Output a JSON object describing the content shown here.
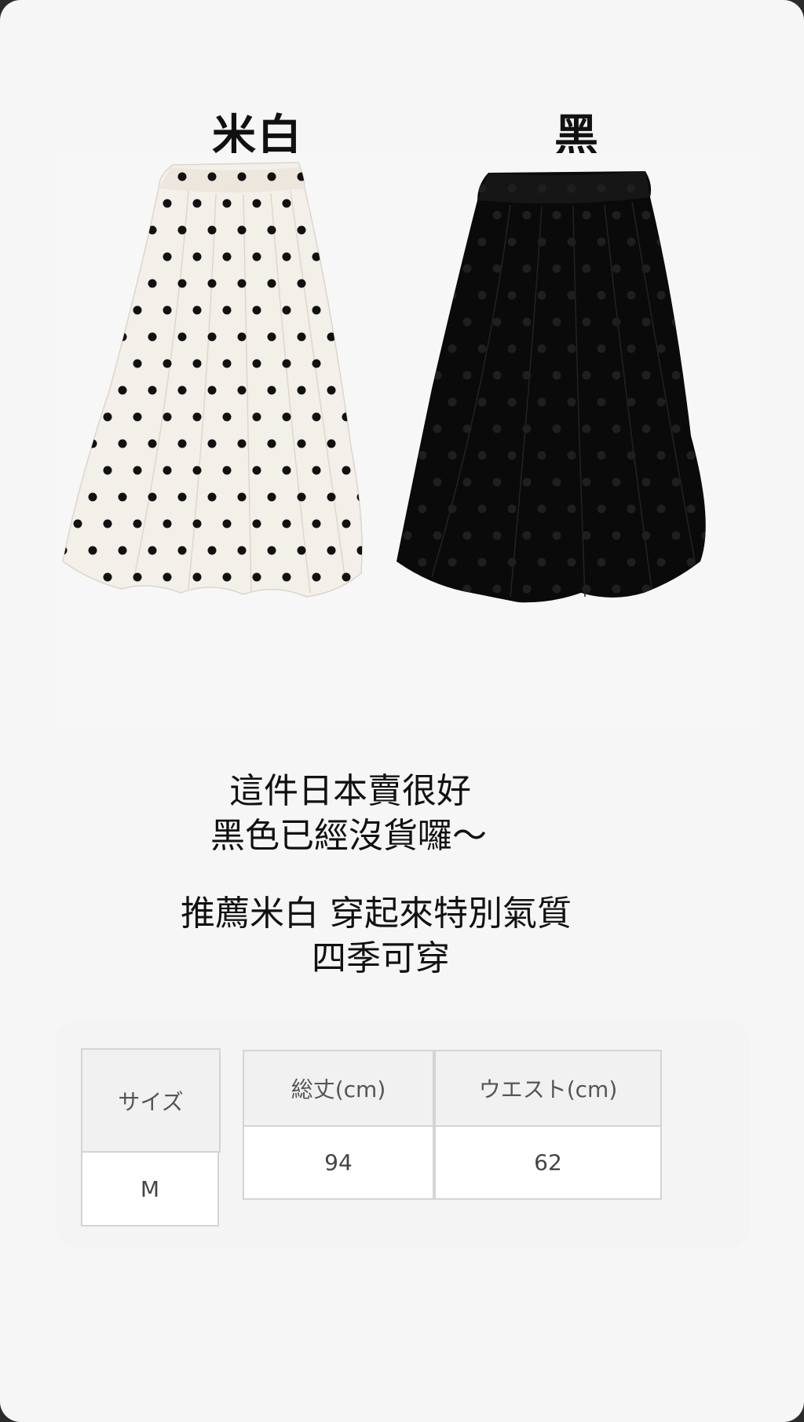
{
  "variants": [
    {
      "label": "米白",
      "color": "#f3efe9"
    },
    {
      "label": "黑",
      "color": "#0a0a0a"
    }
  ],
  "copy": {
    "line1": "這件日本賣很好",
    "line2": "黑色已經沒貨囉～",
    "line3": "推薦米白 穿起來特別氣質",
    "line4": "四季可穿"
  },
  "size_table": {
    "size_header": "サイズ",
    "length_header": "総丈(cm)",
    "waist_header": "ウエスト(cm)",
    "rows": [
      {
        "size": "M",
        "length": "94",
        "waist": "62"
      }
    ]
  },
  "colors": {
    "page_bg": "#f6f6f6",
    "dot": "#111111",
    "cell_border": "#d4d4d4"
  }
}
